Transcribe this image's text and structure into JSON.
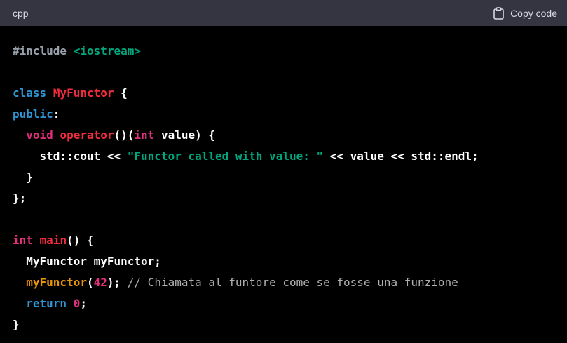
{
  "header": {
    "language": "cpp",
    "copy_label": "Copy code"
  },
  "code_lines": [
    [
      {
        "t": "#include",
        "c": "meta"
      },
      {
        "t": " ",
        "c": "plain"
      },
      {
        "t": "<iostream>",
        "c": "str"
      }
    ],
    [],
    [
      {
        "t": "class",
        "c": "kw"
      },
      {
        "t": " ",
        "c": "plain"
      },
      {
        "t": "MyFunctor",
        "c": "fn"
      },
      {
        "t": " {",
        "c": "plain"
      }
    ],
    [
      {
        "t": "public",
        "c": "kw"
      },
      {
        "t": ":",
        "c": "plain"
      }
    ],
    [
      {
        "t": "  ",
        "c": "plain"
      },
      {
        "t": "void",
        "c": "kw2"
      },
      {
        "t": " ",
        "c": "plain"
      },
      {
        "t": "operator",
        "c": "fn"
      },
      {
        "t": "()(",
        "c": "plain"
      },
      {
        "t": "int",
        "c": "kw2"
      },
      {
        "t": " value) {",
        "c": "plain"
      }
    ],
    [
      {
        "t": "    std::cout << ",
        "c": "plain"
      },
      {
        "t": "\"Functor called with value: \"",
        "c": "str"
      },
      {
        "t": " << value << std::endl;",
        "c": "plain"
      }
    ],
    [
      {
        "t": "  }",
        "c": "plain"
      }
    ],
    [
      {
        "t": "};",
        "c": "plain"
      }
    ],
    [],
    [
      {
        "t": "int",
        "c": "kw2"
      },
      {
        "t": " ",
        "c": "plain"
      },
      {
        "t": "main",
        "c": "fn"
      },
      {
        "t": "() {",
        "c": "plain"
      }
    ],
    [
      {
        "t": "  MyFunctor myFunctor;",
        "c": "plain"
      }
    ],
    [
      {
        "t": "  ",
        "c": "plain"
      },
      {
        "t": "myFunctor",
        "c": "call"
      },
      {
        "t": "(",
        "c": "plain"
      },
      {
        "t": "42",
        "c": "num"
      },
      {
        "t": "); ",
        "c": "plain"
      },
      {
        "t": "// Chiamata al funtore come se fosse una funzione",
        "c": "cmt"
      }
    ],
    [
      {
        "t": "  ",
        "c": "plain"
      },
      {
        "t": "return",
        "c": "kw"
      },
      {
        "t": " ",
        "c": "plain"
      },
      {
        "t": "0",
        "c": "num"
      },
      {
        "t": ";",
        "c": "plain"
      }
    ],
    [
      {
        "t": "}",
        "c": "plain"
      }
    ]
  ]
}
